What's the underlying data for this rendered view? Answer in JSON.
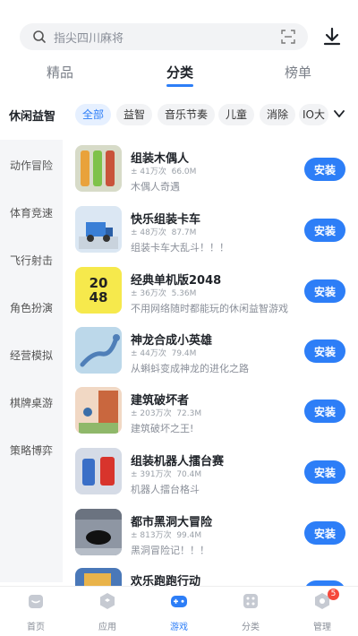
{
  "search": {
    "placeholder": "指尖四川麻将"
  },
  "top_tabs": [
    {
      "label": "精品"
    },
    {
      "label": "分类"
    },
    {
      "label": "榜单"
    }
  ],
  "category_title": "休闲益智",
  "chips": [
    {
      "label": "全部"
    },
    {
      "label": "益智"
    },
    {
      "label": "音乐节奏"
    },
    {
      "label": "儿童"
    },
    {
      "label": "消除"
    },
    {
      "label": "IO大"
    }
  ],
  "side_menu": [
    {
      "label": "动作冒险"
    },
    {
      "label": "体育竞速"
    },
    {
      "label": "飞行射击"
    },
    {
      "label": "角色扮演"
    },
    {
      "label": "经营模拟"
    },
    {
      "label": "棋牌桌游"
    },
    {
      "label": "策略博弈"
    }
  ],
  "games": [
    {
      "name": "组装木偶人",
      "downloads": "± 41万次",
      "size": "66.0M",
      "desc": "木偶人奇遇",
      "button": "安装"
    },
    {
      "name": "快乐组装卡车",
      "downloads": "± 48万次",
      "size": "87.7M",
      "desc": "组装卡车大乱斗！！！",
      "button": "安装"
    },
    {
      "name": "经典单机版2048",
      "downloads": "± 36万次",
      "size": "5.36M",
      "desc": "不用网络随时都能玩的休闲益智游戏",
      "button": "安装",
      "thumb_text": "20 48"
    },
    {
      "name": "神龙合成小英雄",
      "downloads": "± 44万次",
      "size": "79.4M",
      "desc": "从蝌蚪变成神龙的进化之路",
      "button": "安装"
    },
    {
      "name": "建筑破坏者",
      "downloads": "± 203万次",
      "size": "72.3M",
      "desc": "建筑破坏之王!",
      "button": "安装"
    },
    {
      "name": "组装机器人擂台赛",
      "downloads": "± 391万次",
      "size": "70.4M",
      "desc": "机器人擂台格斗",
      "button": "安装"
    },
    {
      "name": "都市黑洞大冒险",
      "downloads": "± 813万次",
      "size": "99.4M",
      "desc": "黑洞冒险记！！！",
      "button": "安装"
    },
    {
      "name": "欢乐跑跑行动",
      "downloads": "",
      "size": "",
      "desc": "",
      "button": ""
    }
  ],
  "bottom_nav": [
    {
      "label": "首页"
    },
    {
      "label": "应用"
    },
    {
      "label": "游戏"
    },
    {
      "label": "分类"
    },
    {
      "label": "管理",
      "badge": "5"
    }
  ],
  "colors": {
    "accent": "#2d7ef7",
    "badge": "#f5483b"
  },
  "icons": [
    "search-icon",
    "scan-icon",
    "download-icon",
    "chevron-down-icon",
    "home-icon",
    "apps-icon",
    "gamepad-icon",
    "category-icon",
    "manage-icon"
  ]
}
